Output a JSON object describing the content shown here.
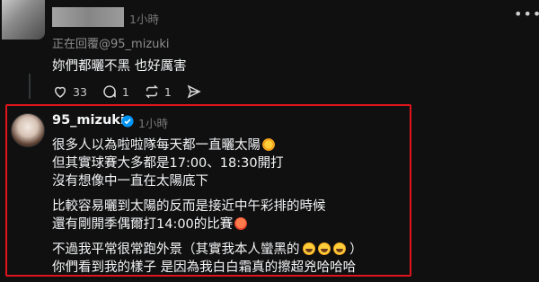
{
  "reply_post": {
    "time": "1小時",
    "reply_to": "正在回覆@95_mizuki",
    "text": "妳們都曬不黑 也好厲害",
    "likes": "33",
    "comments": "1",
    "reposts": "1",
    "more_icon": "more-horizontal-icon"
  },
  "main_post": {
    "username": "95_mizuki",
    "verified": true,
    "time": "1小時",
    "lines": [
      "很多人以為啦啦隊每天都一直曬太陽",
      "但其實球賽大多都是17:00、18:30開打",
      "沒有想像中一直在太陽底下",
      "比較容易曬到太陽的反而是接近中午彩排的時候",
      "還有剛開季偶爾打14:00的比賽",
      "不過我平常很常跑外景（其實我本人蠻黑的",
      "）",
      "你們看到我的樣子 是因為我白白霜真的擦超兇哈哈哈"
    ],
    "highlight_color": "#e0141c",
    "verified_color": "#0095f6"
  }
}
